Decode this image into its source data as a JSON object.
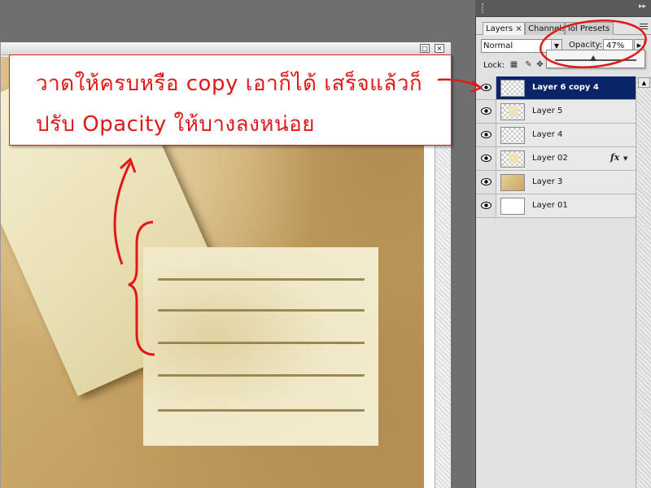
{
  "annotation": {
    "line1": "วาดให้ครบหรือ copy เอาก็ได้ เสร็จแล้วก็",
    "line2": "ปรับ Opacity ให้บางลงหน่อย",
    "color": "#e01818"
  },
  "document": {
    "window_buttons": [
      "□",
      "×"
    ],
    "canvas_colors": {
      "paper": "#dbbf8a",
      "note_card": "#f0e8c8",
      "note_lines": "#a79660"
    },
    "note_line_count": 5
  },
  "layers_panel": {
    "tabs": [
      {
        "label": "Layers ×",
        "active": true
      },
      {
        "label": "Channels",
        "active": false
      },
      {
        "label": "iol Presets",
        "active": false
      }
    ],
    "blend_mode": "Normal",
    "opacity_label": "Opacity:",
    "opacity_value": "47%",
    "opacity_fraction": 0.47,
    "lock_label": "Lock:",
    "layers": [
      {
        "name": "Layer 6 copy 4",
        "selected": true,
        "thumb": "transparent",
        "fx": false
      },
      {
        "name": "Layer 5",
        "selected": false,
        "thumb": "note",
        "fx": false
      },
      {
        "name": "Layer 4",
        "selected": false,
        "thumb": "transparent",
        "fx": false
      },
      {
        "name": "Layer 02",
        "selected": false,
        "thumb": "note",
        "fx": true
      },
      {
        "name": "Layer 3",
        "selected": false,
        "thumb": "paper",
        "fx": false
      },
      {
        "name": "Layer 01",
        "selected": false,
        "thumb": "white",
        "fx": false
      }
    ],
    "fx_label": "fx",
    "selection_color": "#0a246a"
  }
}
